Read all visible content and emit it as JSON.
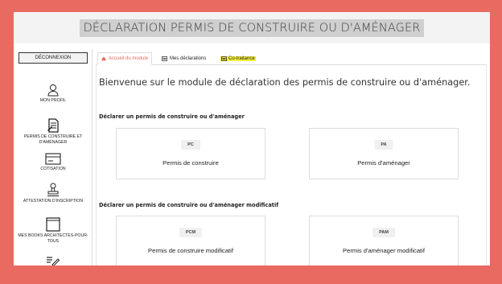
{
  "header": {
    "title": "DÉCLARATION PERMIS DE CONSTRUIRE OU D'AMÉNAGER"
  },
  "sidebar": {
    "logout_label": "DÉCONNEXION",
    "items": [
      {
        "label": "MON PROFIL",
        "icon": "user-icon"
      },
      {
        "label": "PERMIS DE CONSTRUIRE ET D'AMÉNAGER",
        "icon": "document-icon"
      },
      {
        "label": "COTISATION",
        "icon": "card-icon"
      },
      {
        "label": "ATTESTATION D'INSCRIPTION",
        "icon": "stamp-icon"
      },
      {
        "label": "MES BOOKS ARCHITECTES-POUR-TOUS",
        "icon": "book-icon"
      },
      {
        "label": "",
        "icon": "edit-icon"
      }
    ]
  },
  "tabs": [
    {
      "label": "Accueil du module",
      "icon": "home-icon",
      "state": "active"
    },
    {
      "label": "Mes déclarations",
      "icon": "list-icon",
      "state": "normal"
    },
    {
      "label": "Co-traitance",
      "icon": "list-icon",
      "state": "highlight"
    }
  ],
  "main": {
    "welcome": "Bienvenue sur le module de déclaration des permis de construire ou d'aménager.",
    "sections": [
      {
        "title": "Déclarer un permis de construire ou d'aménager",
        "cards": [
          {
            "badge": "PC",
            "label": "Permis de construire"
          },
          {
            "badge": "PA",
            "label": "Permis d'aménager"
          }
        ]
      },
      {
        "title": "Déclarer un permis de construire ou d'aménager modificatif",
        "cards": [
          {
            "badge": "PCM",
            "label": "Permis de construire modificatif"
          },
          {
            "badge": "PAM",
            "label": "Permis d'aménager modificatif"
          }
        ]
      }
    ]
  },
  "colors": {
    "background": "#e96a61",
    "accent": "#e96a61",
    "highlight": "#f2ee3a"
  }
}
